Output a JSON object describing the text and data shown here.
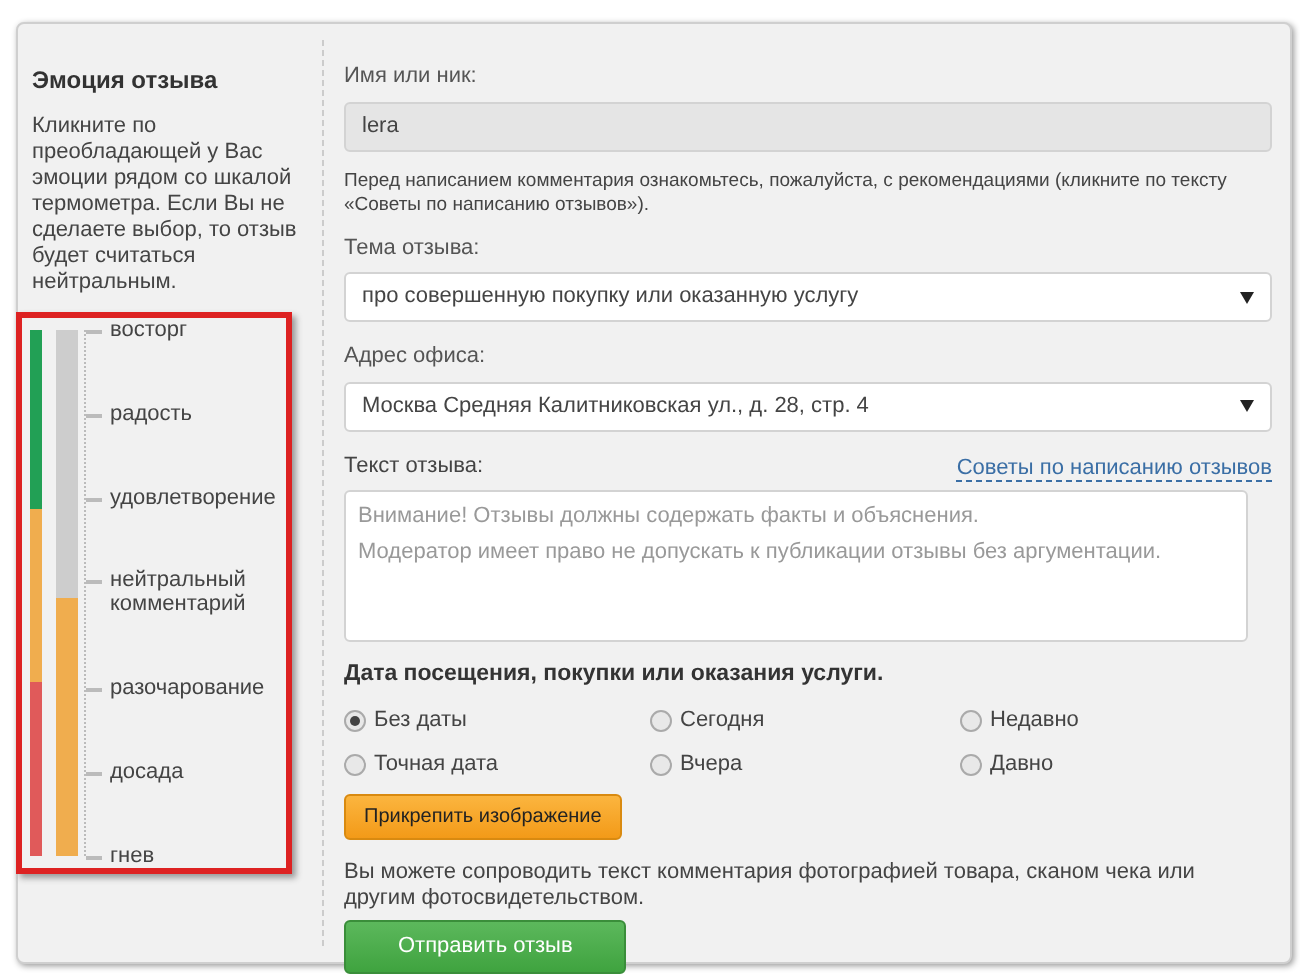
{
  "sidebar": {
    "title": "Эмоция отзыва",
    "hint": "Кликните по преобладающей у Вас эмоции рядом со шкалой термометра. Если Вы не сделаете выбор, то отзыв будет считаться нейтральным.",
    "thermometer": {
      "level": 0.49,
      "labels": [
        "восторг",
        "радость",
        "удовлетворение",
        "нейтральный комментарий",
        "разочарование",
        "досада",
        "гнев"
      ]
    }
  },
  "form": {
    "name_label": "Имя или ник:",
    "name_value": "lera",
    "notice": "Перед написанием комментария ознакомьтесь, пожалуйста, с рекомендациями (кликните по тексту «Советы по написанию отзывов»).",
    "topic_label": "Тема отзыва:",
    "topic_value": "про совершенную покупку или оказанную услугу",
    "office_label": "Адрес офиса:",
    "office_value": "Москва Средняя Калитниковская ул., д. 28, стр. 4",
    "text_label": "Текст отзыва:",
    "tips_link": "Советы по написанию отзывов",
    "text_placeholder": "Внимание! Отзывы должны содержать факты и объяснения.\nМодератор имеет право не допускать к публикации отзывы без аргументации.",
    "date_heading": "Дата посещения, покупки или оказания услуги.",
    "date_options": [
      {
        "label": "Без даты",
        "selected": true
      },
      {
        "label": "Сегодня",
        "selected": false
      },
      {
        "label": "Недавно",
        "selected": false
      },
      {
        "label": "Точная дата",
        "selected": false
      },
      {
        "label": "Вчера",
        "selected": false
      },
      {
        "label": "Давно",
        "selected": false
      }
    ],
    "attach_button": "Прикрепить изображение",
    "photo_note": "Вы можете сопроводить текст комментария фотографией товара, сканом чека или другим фотосвидетельством.",
    "submit_button": "Отправить отзыв"
  }
}
